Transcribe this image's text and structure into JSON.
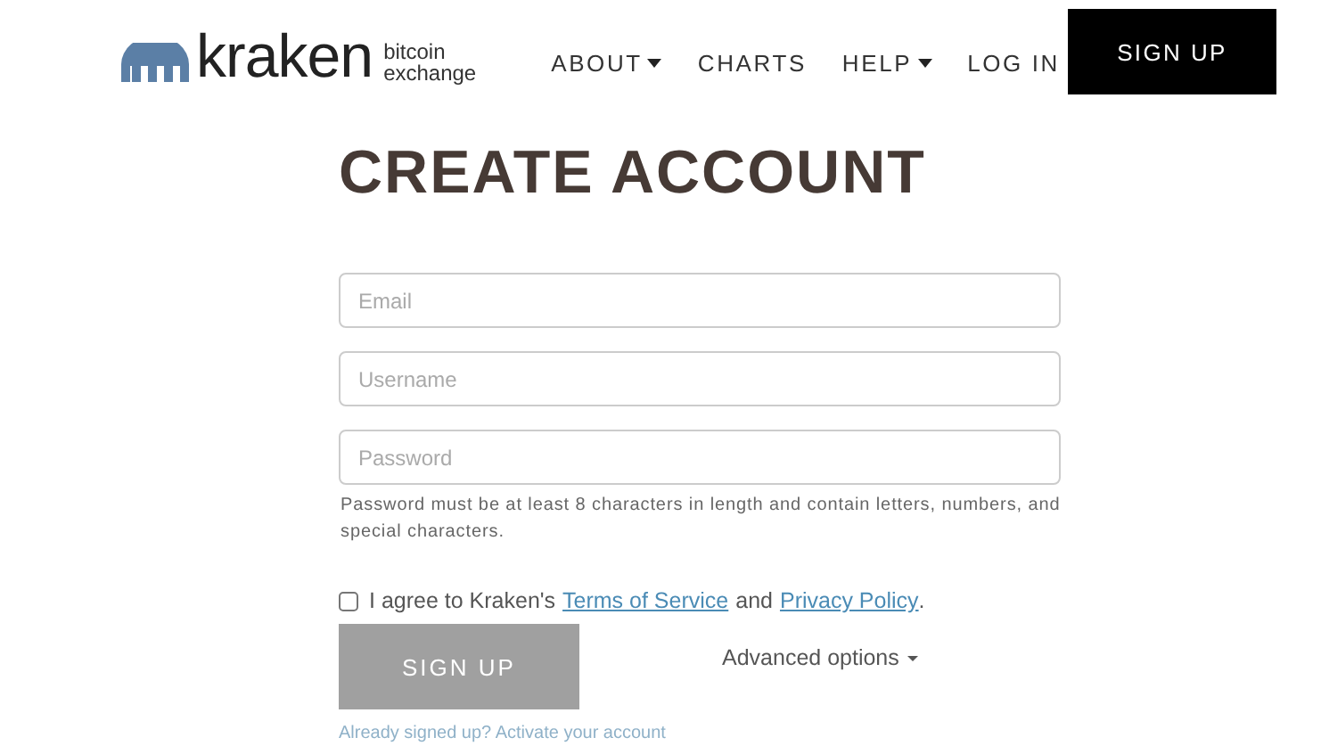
{
  "header": {
    "logo": {
      "name": "kraken",
      "tagline_1": "bitcoin",
      "tagline_2": "exchange"
    },
    "nav": [
      {
        "label": "ABOUT",
        "dropdown": true
      },
      {
        "label": "CHARTS",
        "dropdown": false
      },
      {
        "label": "HELP",
        "dropdown": true
      },
      {
        "label": "LOG IN",
        "dropdown": false
      }
    ],
    "signup_button": "SIGN UP"
  },
  "form": {
    "title": "CREATE ACCOUNT",
    "fields": [
      {
        "placeholder": "Email"
      },
      {
        "placeholder": "Username"
      },
      {
        "placeholder": "Password"
      }
    ],
    "password_hint": "Password must be at least 8 characters in length and contain letters, numbers, and special characters.",
    "agree": {
      "checked": false,
      "text_1": "I agree to Kraken's",
      "terms_link": "Terms of Service",
      "text_2": "and",
      "privacy_link": "Privacy Policy",
      "text_3": "."
    },
    "submit_button": "SIGN UP",
    "advanced_options": "Advanced options",
    "footer_link": "Already signed up? Activate your account"
  }
}
